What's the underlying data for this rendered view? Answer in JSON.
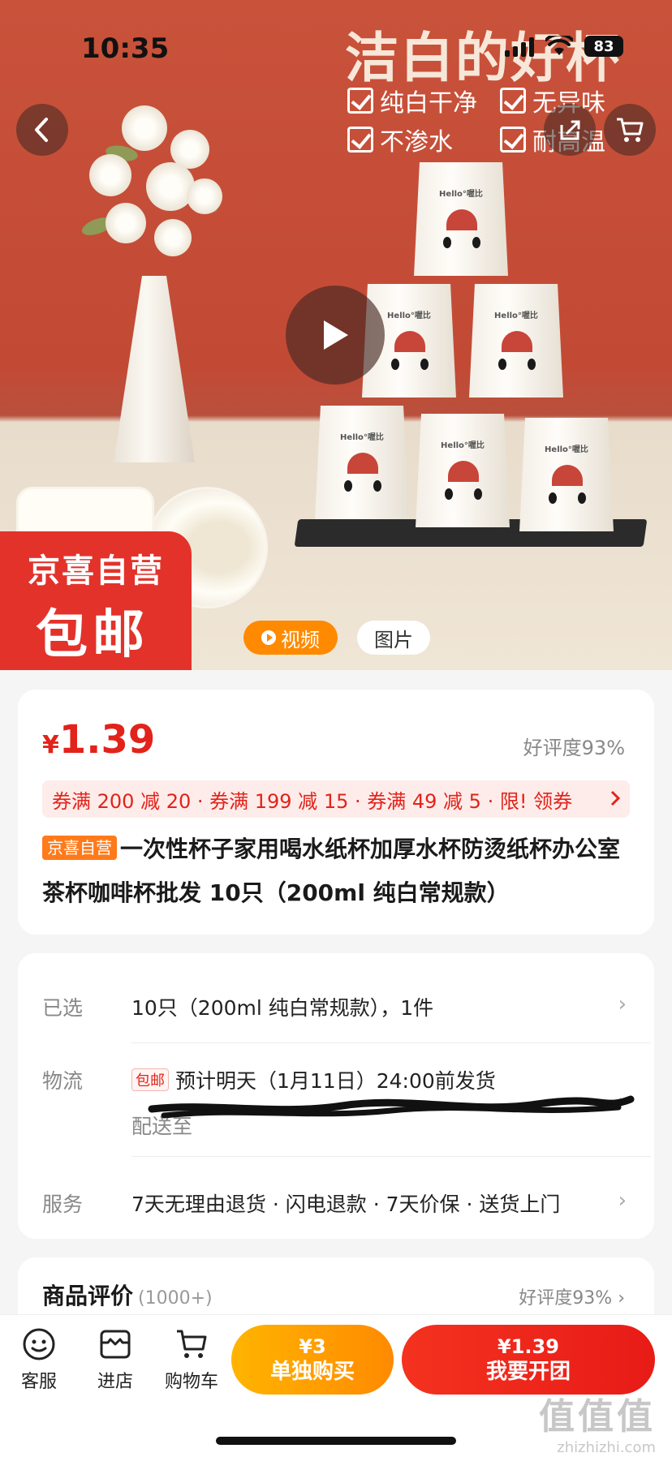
{
  "status": {
    "time": "10:35",
    "battery": "83"
  },
  "hero": {
    "headline": "洁白的好杯",
    "features": [
      "纯白干净",
      "无异味",
      "不渗水",
      "耐高温"
    ],
    "cup_brand": "Hello°喔比",
    "badge_line1": "京喜自营",
    "badge_line2": "包邮",
    "media_tabs": {
      "video": "视频",
      "photo": "图片"
    }
  },
  "product": {
    "price_symbol": "¥",
    "price": "1.39",
    "rating": "好评度93%",
    "coupons": "券满 200 减 20 · 券满 199 减 15 · 券满 49 减 5 · 限! 领券",
    "tag": "京喜自营",
    "title": "一次性杯子家用喝水纸杯加厚水杯防烫纸杯办公室茶杯咖啡杯批发 10只（200ml 纯白常规款）"
  },
  "spec": {
    "selected_label": "已选",
    "selected_value": "10只（200ml 纯白常规款），1件",
    "logistics_label": "物流",
    "logistics_tag": "包邮",
    "logistics_value": "预计明天（1月11日）24:00前发货",
    "delivery_prefix": "配送至",
    "service_label": "服务",
    "service_value": "7天无理由退货 · 闪电退款 · 7天价保 · 送货上门"
  },
  "review": {
    "title": "商品评价",
    "count": "(1000+)",
    "rating": "好评度93%"
  },
  "bottom_bar": {
    "service": "客服",
    "store": "进店",
    "cart": "购物车",
    "solo_price": "¥3",
    "solo_label": "单独购买",
    "group_price": "¥1.39",
    "group_label": "我要开团"
  },
  "watermark": {
    "big": "值值值",
    "small": "zhizhizhi.com"
  },
  "colors": {
    "accent_red": "#e2231a",
    "orange": "#ff8a00",
    "hero_red": "#c9523b"
  }
}
